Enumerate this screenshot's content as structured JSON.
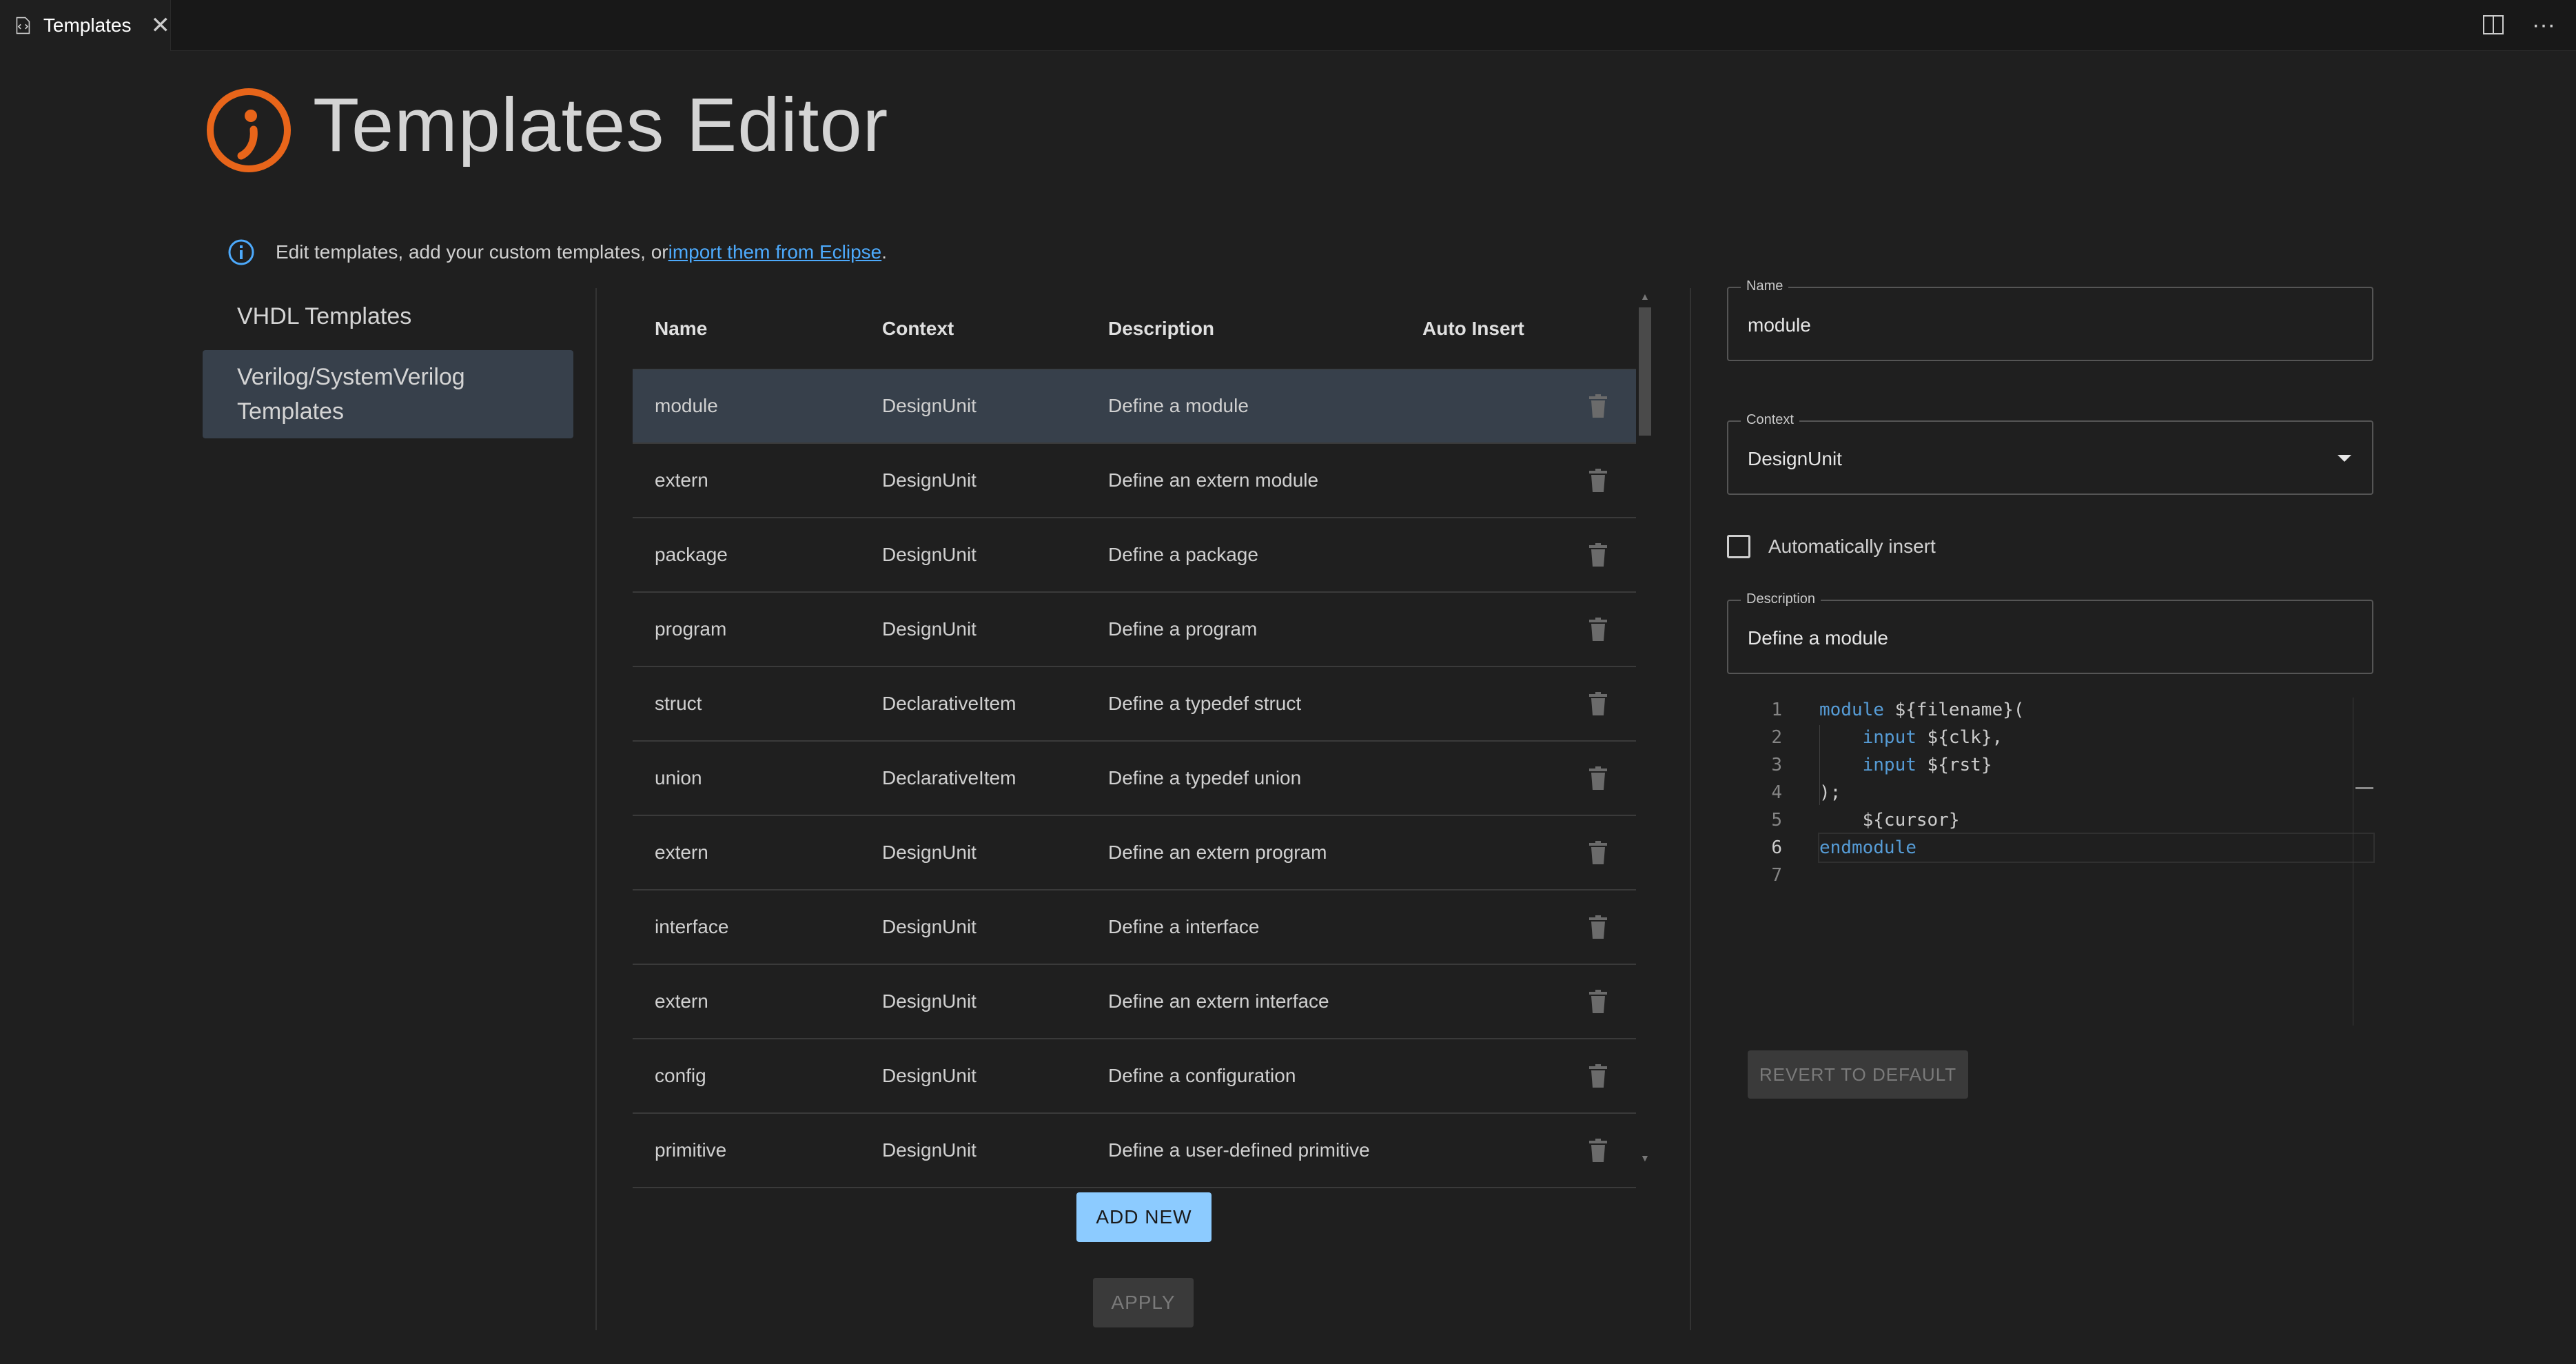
{
  "tab": {
    "label": "Templates",
    "close_glyph": "✕",
    "icon": "file-code-icon"
  },
  "tab_actions": {
    "split_glyph": "◫",
    "more_glyph": "···"
  },
  "header": {
    "title": "Templates Editor",
    "logo": "sigasi-logo-icon",
    "accent": "#e8651a"
  },
  "info": {
    "text": "Edit templates, add your custom templates, or ",
    "link": "import them from Eclipse",
    "suffix": "."
  },
  "nav": {
    "items": [
      {
        "label": "VHDL Templates"
      },
      {
        "label": "Verilog/SystemVerilog Templates",
        "active": true
      }
    ]
  },
  "table": {
    "headers": {
      "name": "Name",
      "context": "Context",
      "description": "Description",
      "auto_insert": "Auto Insert"
    },
    "rows": [
      {
        "name": "module",
        "context": "DesignUnit",
        "description": "Define a module",
        "selected": true
      },
      {
        "name": "extern",
        "context": "DesignUnit",
        "description": "Define an extern module"
      },
      {
        "name": "package",
        "context": "DesignUnit",
        "description": "Define a package"
      },
      {
        "name": "program",
        "context": "DesignUnit",
        "description": "Define a program"
      },
      {
        "name": "struct",
        "context": "DeclarativeItem",
        "description": "Define a typedef struct"
      },
      {
        "name": "union",
        "context": "DeclarativeItem",
        "description": "Define a typedef union"
      },
      {
        "name": "extern",
        "context": "DesignUnit",
        "description": "Define an extern program"
      },
      {
        "name": "interface",
        "context": "DesignUnit",
        "description": "Define a interface"
      },
      {
        "name": "extern",
        "context": "DesignUnit",
        "description": "Define an extern interface"
      },
      {
        "name": "config",
        "context": "DesignUnit",
        "description": "Define a configuration"
      },
      {
        "name": "primitive",
        "context": "DesignUnit",
        "description": "Define a user-defined primitive"
      }
    ]
  },
  "buttons": {
    "add_new": "ADD NEW",
    "apply": "APPLY",
    "revert": "REVERT TO DEFAULT"
  },
  "form": {
    "name_label": "Name",
    "name_value": "module",
    "context_label": "Context",
    "context_value": "DesignUnit",
    "auto_insert_label": "Automatically insert",
    "auto_insert_checked": false,
    "description_label": "Description",
    "description_value": "Define a module"
  },
  "editor": {
    "lines": [
      {
        "n": "1",
        "kw": "module",
        "rest": " ${filename}("
      },
      {
        "n": "2",
        "indent": "    ",
        "kw": "input",
        "rest": " ${clk},"
      },
      {
        "n": "3",
        "indent": "    ",
        "kw": "input",
        "rest": " ${rst}"
      },
      {
        "n": "4",
        "rest": ");"
      },
      {
        "n": "5",
        "rest": "    ${cursor}"
      },
      {
        "n": "6",
        "kw": "endmodule",
        "rest": "",
        "current": true
      },
      {
        "n": "7",
        "rest": ""
      }
    ]
  },
  "colors": {
    "background": "#1f1f1f",
    "selected_row": "#37404b",
    "primary_button": "#8ccbff",
    "link": "#4daafc",
    "keyword": "#569cd6"
  }
}
